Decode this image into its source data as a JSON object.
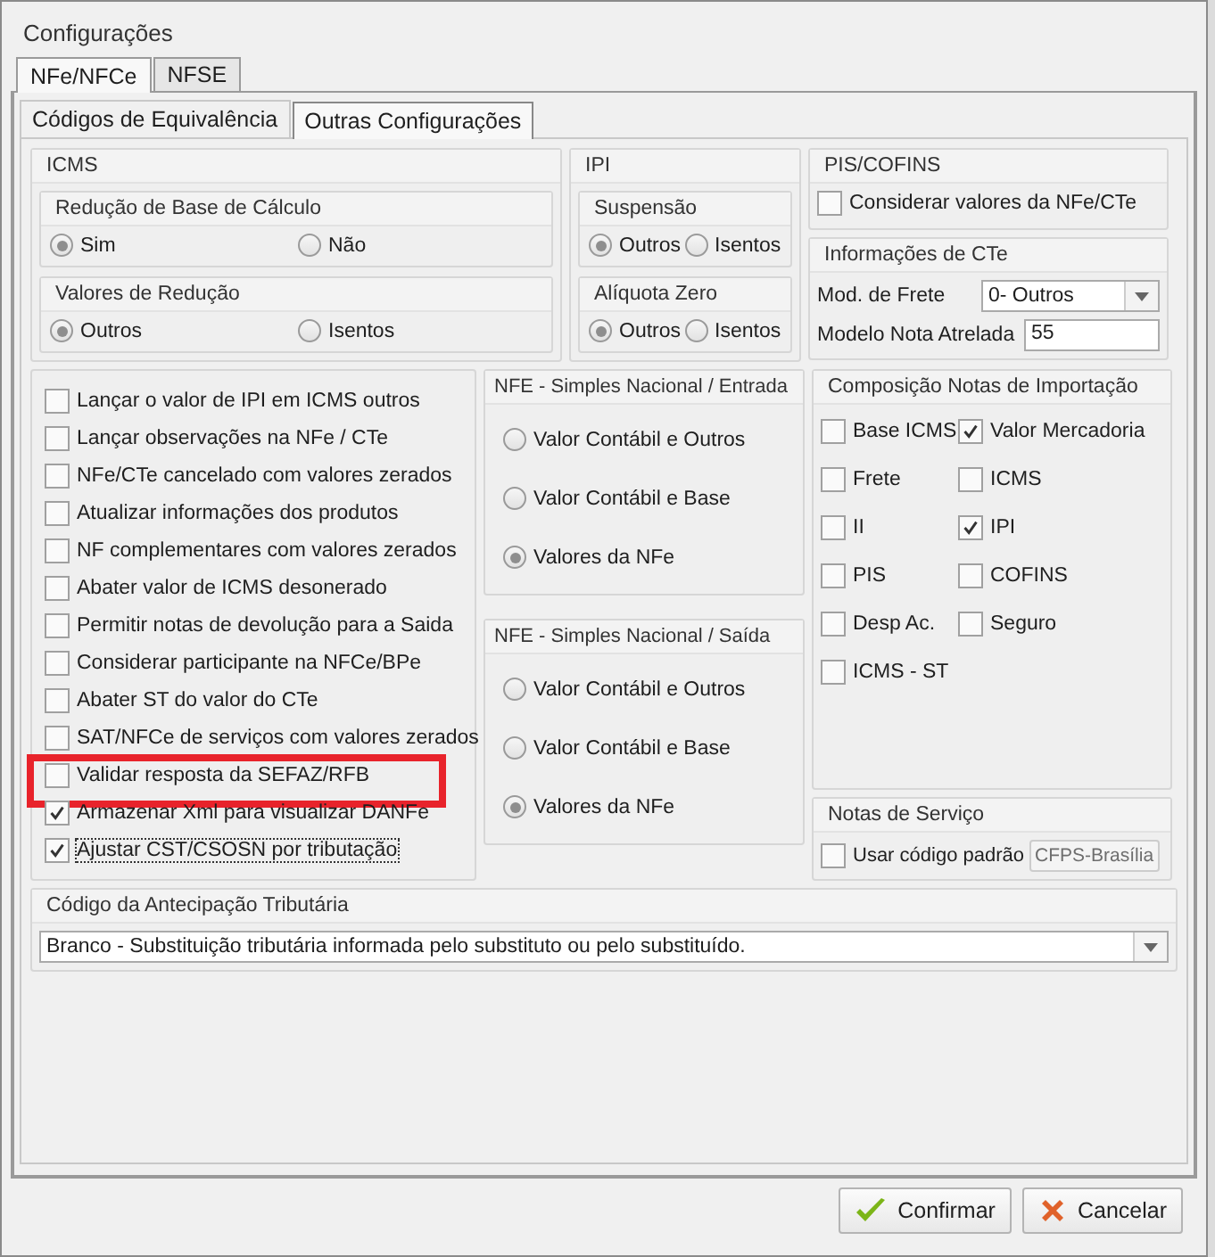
{
  "window": {
    "title": "Configurações"
  },
  "tabs": [
    {
      "label": "NFe/NFCe",
      "selected": true
    },
    {
      "label": "NFSE",
      "selected": false
    }
  ],
  "subtabs": [
    {
      "label": "Códigos de Equivalência",
      "selected": false
    },
    {
      "label": "Outras Configurações",
      "selected": true
    }
  ],
  "icms": {
    "title": "ICMS",
    "groups": [
      {
        "title": "Redução de Base de Cálculo",
        "options": [
          {
            "label": "Sim",
            "selected": true
          },
          {
            "label": "Não",
            "selected": false
          }
        ]
      },
      {
        "title": "Valores de Redução",
        "options": [
          {
            "label": "Outros",
            "selected": true
          },
          {
            "label": "Isentos",
            "selected": false
          }
        ]
      }
    ]
  },
  "ipi": {
    "title": "IPI",
    "groups": [
      {
        "title": "Suspensão",
        "options": [
          {
            "label": "Outros",
            "selected": true
          },
          {
            "label": "Isentos",
            "selected": false
          }
        ]
      },
      {
        "title": "Alíquota Zero",
        "options": [
          {
            "label": "Outros",
            "selected": true
          },
          {
            "label": "Isentos",
            "selected": false
          }
        ]
      }
    ]
  },
  "pis_cofins": {
    "title": "PIS/COFINS",
    "checkbox": {
      "label": "Considerar valores da NFe/CTe",
      "checked": false
    }
  },
  "cte": {
    "title": "Informações de CTe",
    "fields": [
      {
        "label": "Mod. de Frete",
        "kind": "dropdown",
        "value": "0- Outros"
      },
      {
        "label": "Modelo Nota Atrelada",
        "kind": "text",
        "value": "55"
      }
    ]
  },
  "options": [
    {
      "label": "Lançar o valor de IPI em ICMS outros",
      "checked": false,
      "highlighted": false,
      "focused": false
    },
    {
      "label": "Lançar observações na NFe / CTe",
      "checked": false,
      "highlighted": false,
      "focused": false
    },
    {
      "label": "NFe/CTe cancelado com valores zerados",
      "checked": false,
      "highlighted": false,
      "focused": false
    },
    {
      "label": "Atualizar informações dos produtos",
      "checked": false,
      "highlighted": false,
      "focused": false
    },
    {
      "label": "NF complementares com valores zerados",
      "checked": false,
      "highlighted": false,
      "focused": false
    },
    {
      "label": "Abater valor de ICMS desonerado",
      "checked": false,
      "highlighted": false,
      "focused": false
    },
    {
      "label": "Permitir notas de devolução para a Saida",
      "checked": false,
      "highlighted": false,
      "focused": false
    },
    {
      "label": "Considerar participante na NFCe/BPe",
      "checked": false,
      "highlighted": false,
      "focused": false
    },
    {
      "label": "Abater ST do valor do CTe",
      "checked": false,
      "highlighted": false,
      "focused": false
    },
    {
      "label": "SAT/NFCe de serviços com valores zerados",
      "checked": false,
      "highlighted": false,
      "focused": false
    },
    {
      "label": "Validar resposta da SEFAZ/RFB",
      "checked": false,
      "highlighted": true,
      "focused": false
    },
    {
      "label": "Armazenar Xml para visualizar DANFe",
      "checked": true,
      "highlighted": false,
      "focused": false
    },
    {
      "label": "Ajustar CST/CSOSN por tributação",
      "checked": true,
      "highlighted": false,
      "focused": true
    }
  ],
  "simples_entrada": {
    "title": "NFE - Simples Nacional / Entrada",
    "options": [
      {
        "label": "Valor Contábil e Outros",
        "selected": false
      },
      {
        "label": "Valor Contábil e Base",
        "selected": false
      },
      {
        "label": "Valores da NFe",
        "selected": true
      }
    ]
  },
  "simples_saida": {
    "title": "NFE - Simples Nacional / Saída",
    "options": [
      {
        "label": "Valor Contábil e Outros",
        "selected": false
      },
      {
        "label": "Valor Contábil e Base",
        "selected": false
      },
      {
        "label": "Valores da NFe",
        "selected": true
      }
    ]
  },
  "importacao": {
    "title": "Composição Notas de Importação",
    "items": [
      {
        "label": "Base ICMS",
        "checked": false
      },
      {
        "label": "Valor Mercadoria",
        "checked": true
      },
      {
        "label": "Frete",
        "checked": false
      },
      {
        "label": "ICMS",
        "checked": false
      },
      {
        "label": "II",
        "checked": false
      },
      {
        "label": "IPI",
        "checked": true
      },
      {
        "label": "PIS",
        "checked": false
      },
      {
        "label": "COFINS",
        "checked": false
      },
      {
        "label": "Desp Ac.",
        "checked": false
      },
      {
        "label": "Seguro",
        "checked": false
      },
      {
        "label": "ICMS - ST",
        "checked": false
      }
    ]
  },
  "notas_servico": {
    "title": "Notas de Serviço",
    "checkbox": {
      "label": "Usar código padrão",
      "checked": false
    },
    "field": {
      "value": "CFPS-Brasília",
      "disabled": true
    }
  },
  "antecipacao": {
    "title": "Código da Antecipação Tributária",
    "value": "Branco - Substituição tributária informada pelo substituto ou pelo substituído."
  },
  "buttons": [
    {
      "label": "Confirmar",
      "kind": "confirm"
    },
    {
      "label": "Cancelar",
      "kind": "cancel"
    }
  ]
}
